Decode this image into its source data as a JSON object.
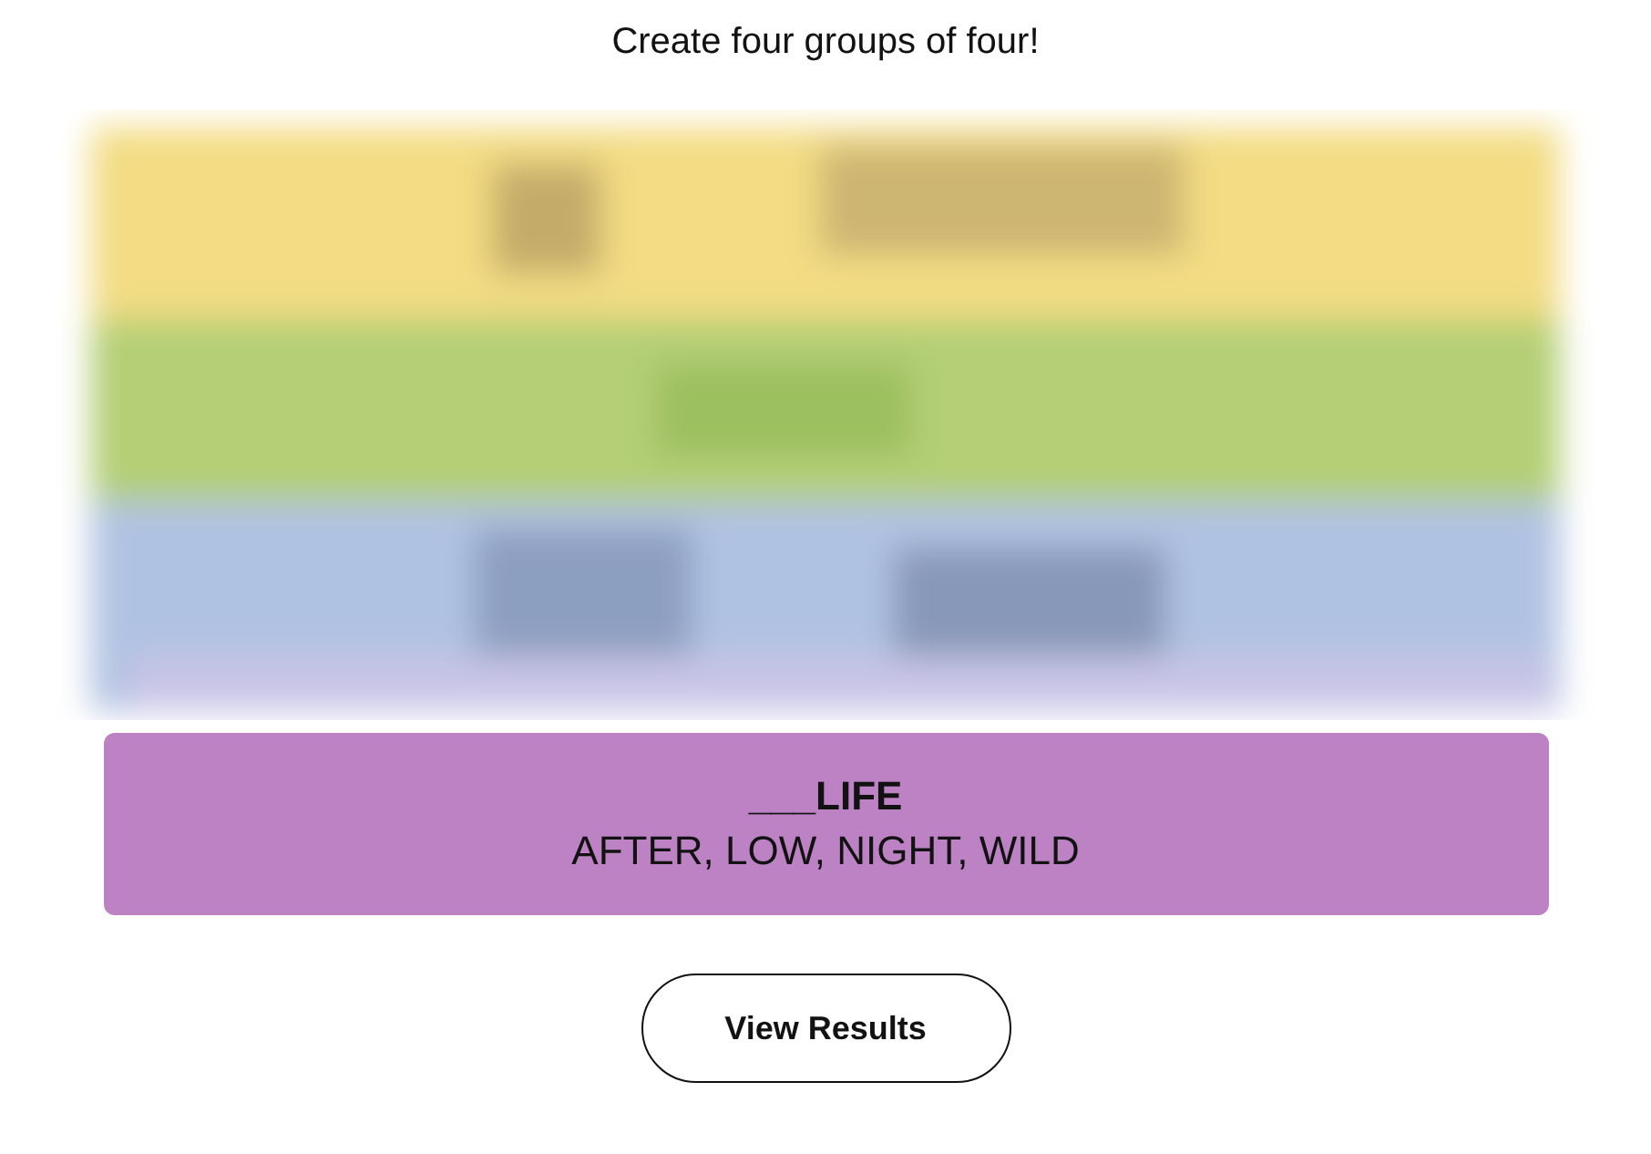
{
  "instruction": "Create four groups of four!",
  "solved_groups": [
    {
      "title": "___LIFE",
      "members": "AFTER, LOW, NIGHT, WILD",
      "color": "#bc82c4"
    }
  ],
  "buttons": [
    "View Results"
  ]
}
